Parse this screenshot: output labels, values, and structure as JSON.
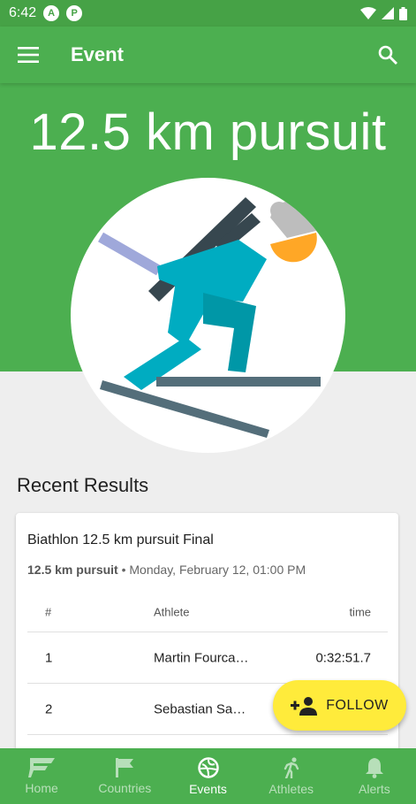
{
  "status_bar": {
    "time": "6:42",
    "icon_a": "A",
    "icon_b": "P"
  },
  "app_bar": {
    "title": "Event"
  },
  "hero": {
    "title": "12.5 km pursuit"
  },
  "recent_results": {
    "heading": "Recent Results",
    "card": {
      "title": "Biathlon 12.5 km pursuit Final",
      "event": "12.5 km pursuit",
      "separator": "•",
      "date": "Monday, February 12, 01:00 PM",
      "columns": {
        "rank": "#",
        "athlete": "Athlete",
        "time": "time"
      },
      "rows": [
        {
          "rank": "1",
          "athlete": "Martin Fourca…",
          "time": "0:32:51.7"
        },
        {
          "rank": "2",
          "athlete": "Sebastian Sa…",
          "time": ""
        }
      ]
    }
  },
  "fab": {
    "label": "FOLLOW",
    "icon": "person-add-icon"
  },
  "bottom_nav": {
    "items": [
      {
        "label": "Home",
        "icon": "home-logo-icon",
        "active": false
      },
      {
        "label": "Countries",
        "icon": "flag-icon",
        "active": false
      },
      {
        "label": "Events",
        "icon": "ball-icon",
        "active": true
      },
      {
        "label": "Athletes",
        "icon": "runner-icon",
        "active": false
      },
      {
        "label": "Alerts",
        "icon": "bell-icon",
        "active": false
      }
    ]
  },
  "colors": {
    "primary": "#4caf50",
    "accent": "#ffeb3b",
    "background": "#eeeeee"
  }
}
